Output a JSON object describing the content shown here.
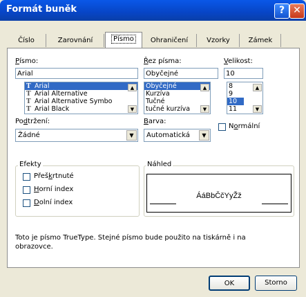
{
  "window": {
    "title": "Formát buněk",
    "help": "?",
    "close": "✕"
  },
  "tabs": [
    "Číslo",
    "Zarovnání",
    "Písmo",
    "Ohraničení",
    "Vzorky",
    "Zámek"
  ],
  "font": {
    "label_u": "P",
    "label_rest": "ísmo:",
    "value": "Arial",
    "items": [
      "Arial",
      "Arial Alternative",
      "Arial Alternative Symbo",
      "Arial Black"
    ],
    "type_glyph": "T"
  },
  "style": {
    "label_u": "Ř",
    "label_rest": "ez písma:",
    "value": "Obyčejné",
    "items": [
      "Obyčejné",
      "Kurzíva",
      "Tučné",
      "tučné kurzíva"
    ]
  },
  "size": {
    "label_u": "V",
    "label_rest": "elikost:",
    "value": "10",
    "items": [
      "8",
      "9",
      "10",
      "11"
    ]
  },
  "underline": {
    "label_pre": "Po",
    "label_u": "d",
    "label_rest": "tržení:",
    "value": "Žádné"
  },
  "color": {
    "label_u": "B",
    "label_rest": "arva:",
    "value": "Automatická"
  },
  "normal": {
    "label_pre": "N",
    "label_u": "o",
    "label_rest": "rmální"
  },
  "effects": {
    "title": "Efekty",
    "items": [
      {
        "pre": "Přeš",
        "u": "k",
        "rest": "rtnuté"
      },
      {
        "pre": "",
        "u": "H",
        "rest": "orní index"
      },
      {
        "pre": "",
        "u": "D",
        "rest": "olní index"
      }
    ]
  },
  "preview": {
    "title": "Náhled",
    "sample": "ÁáBbČčYyŽž"
  },
  "info": "Toto je písmo TrueType. Stejné písmo bude použito na tiskárně i na obrazovce.",
  "buttons": {
    "ok": "OK",
    "cancel": "Storno"
  },
  "colors": {
    "titlebar": "#0a58e8",
    "selection": "#316ac5",
    "dialog_bg": "#ece9d8"
  }
}
